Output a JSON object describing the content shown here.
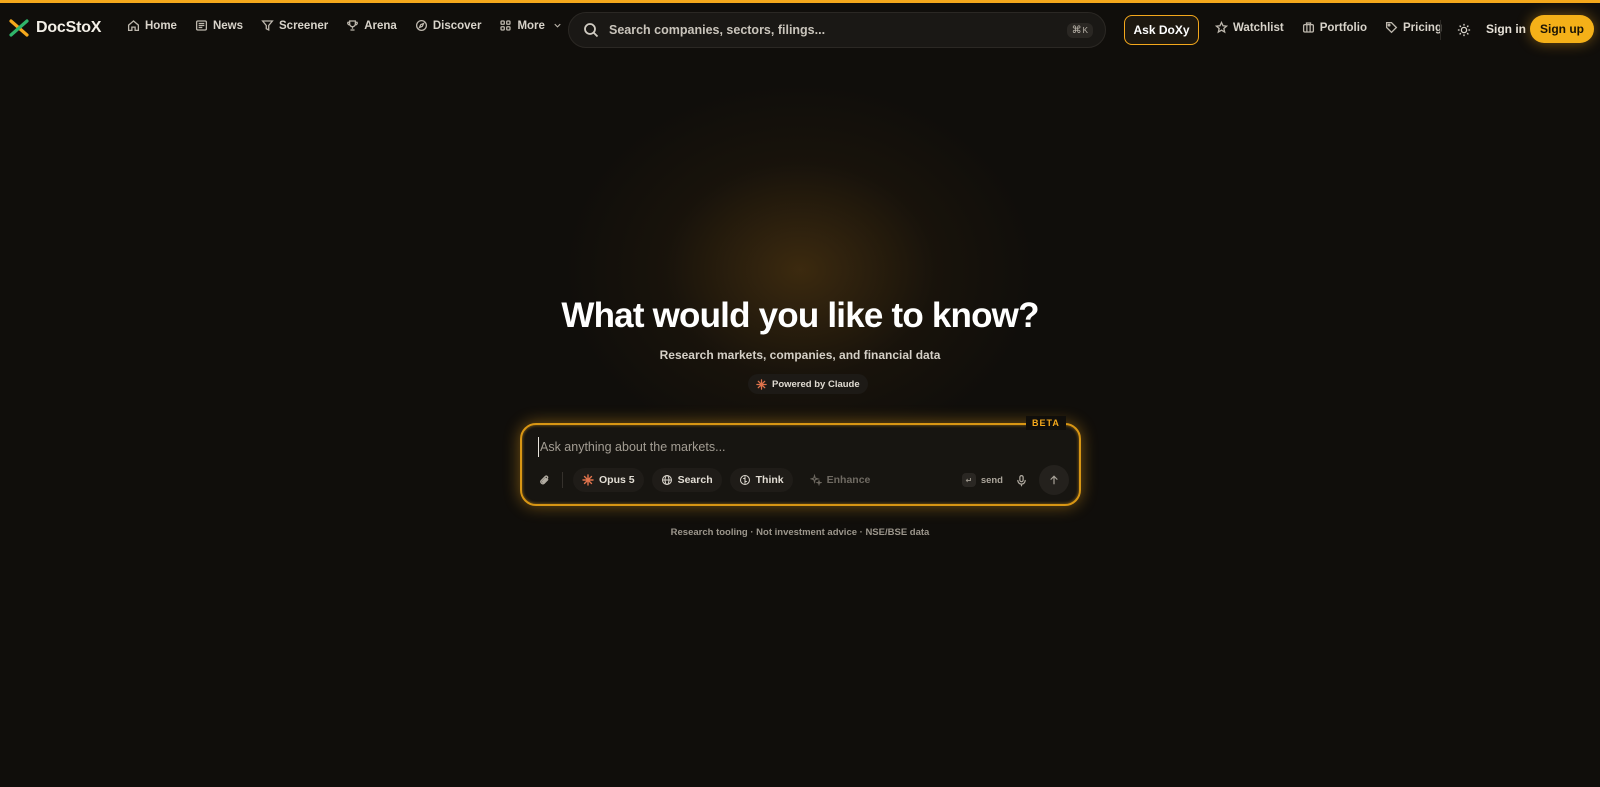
{
  "brand": {
    "name": "DocStoX",
    "accent": "#f4a81c",
    "background": "#100e0b"
  },
  "nav": {
    "links": [
      {
        "label": "Home",
        "icon": "home-icon"
      },
      {
        "label": "News",
        "icon": "newspaper-icon"
      },
      {
        "label": "Screener",
        "icon": "filter-icon"
      },
      {
        "label": "Arena",
        "icon": "trophy-icon"
      },
      {
        "label": "Discover",
        "icon": "compass-icon"
      },
      {
        "label": "More",
        "icon": "grid-icon"
      }
    ],
    "search_placeholder": "Search companies, sectors, filings...",
    "search_shortcut_symbol": "⌘",
    "search_shortcut_key": "K",
    "ask_label": "Ask DoXy",
    "right_links": [
      {
        "label": "Watchlist",
        "icon": "star-icon"
      },
      {
        "label": "Portfolio",
        "icon": "briefcase-icon"
      },
      {
        "label": "Pricing",
        "icon": "tag-icon"
      }
    ],
    "signin_label": "Sign in",
    "signup_label": "Sign up"
  },
  "hero": {
    "title": "What would you like to know?",
    "subtitle": "Research markets, companies, and financial data",
    "powered_by": "Powered by Claude"
  },
  "chat": {
    "badge": "BETA",
    "placeholder": "Ask anything about the markets...",
    "model_label": "Opus 5",
    "search_label": "Search",
    "think_label": "Think",
    "enhance_label": "Enhance",
    "send_hint": "send",
    "send_key": "↵"
  },
  "footnote": "Research tooling · Not investment advice · NSE/BSE data"
}
